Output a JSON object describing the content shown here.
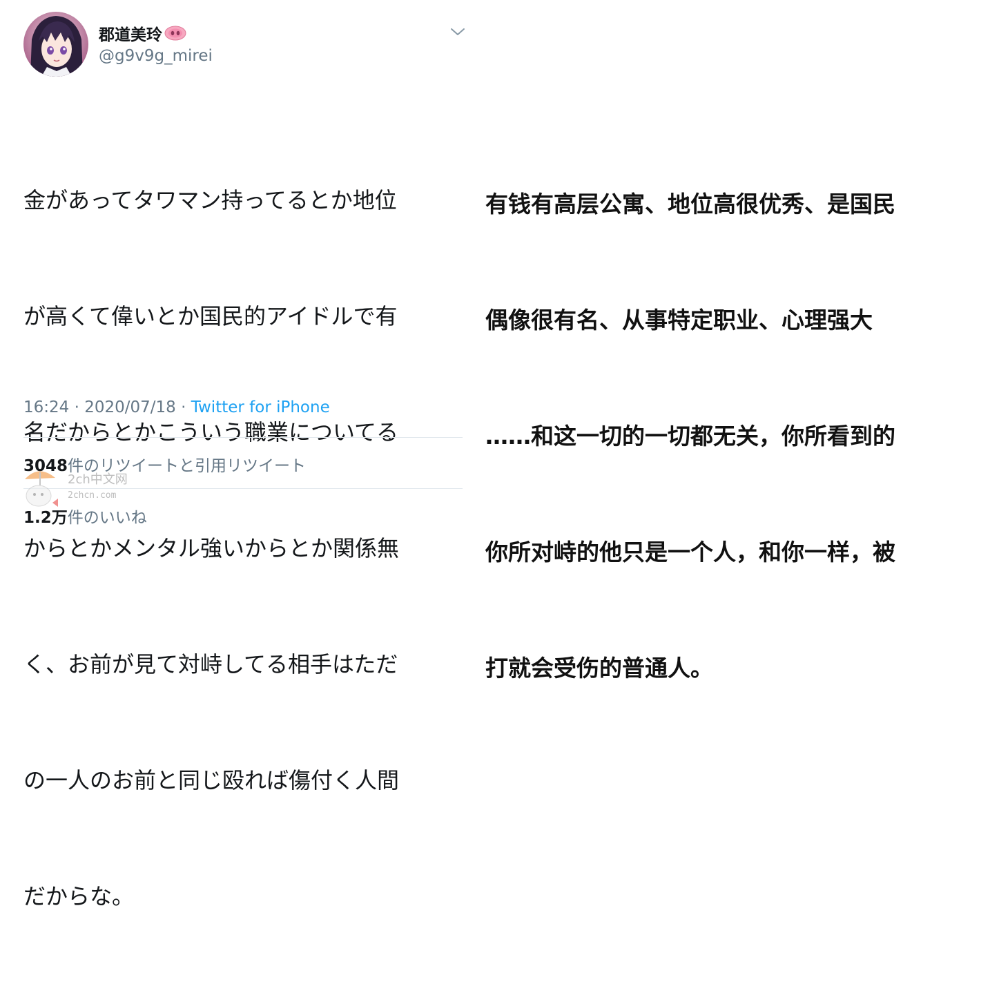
{
  "tweet": {
    "display_name": "郡道美玲",
    "name_emoji": "pig-nose-emoji",
    "handle": "@g9v9g_mirei",
    "text_lines": [
      "金があってタワマン持ってるとか地位",
      "が高くて偉いとか国民的アイドルで有",
      "名だからとかこういう職業についてる",
      "からとかメンタル強いからとか関係無",
      "く、お前が見て対峙してる相手はただ",
      "の一人のお前と同じ殴れば傷付く人間",
      "だからな。"
    ],
    "time": "16:24",
    "separator": " · ",
    "date": "2020/07/18",
    "source": "Twitter for iPhone",
    "retweet_count": "3048",
    "retweet_label": "件のリツイートと引用リツイート",
    "like_count": "1.2万",
    "like_label": "件のいいね"
  },
  "translation": {
    "lines": [
      "有钱有高层公寓、地位高很优秀、是国民",
      "偶像很有名、从事特定职业、心理强大",
      "……和这一切的一切都无关，你所看到的",
      "你所对峙的他只是一个人，和你一样，被",
      "打就会受伤的普通人。"
    ]
  },
  "watermark": {
    "line1": "2ch中文网",
    "line2": "2chcn.com"
  },
  "colors": {
    "text": "#14171a",
    "secondary": "#657786",
    "link": "#1da1f2",
    "divider": "#e1e8ed"
  }
}
